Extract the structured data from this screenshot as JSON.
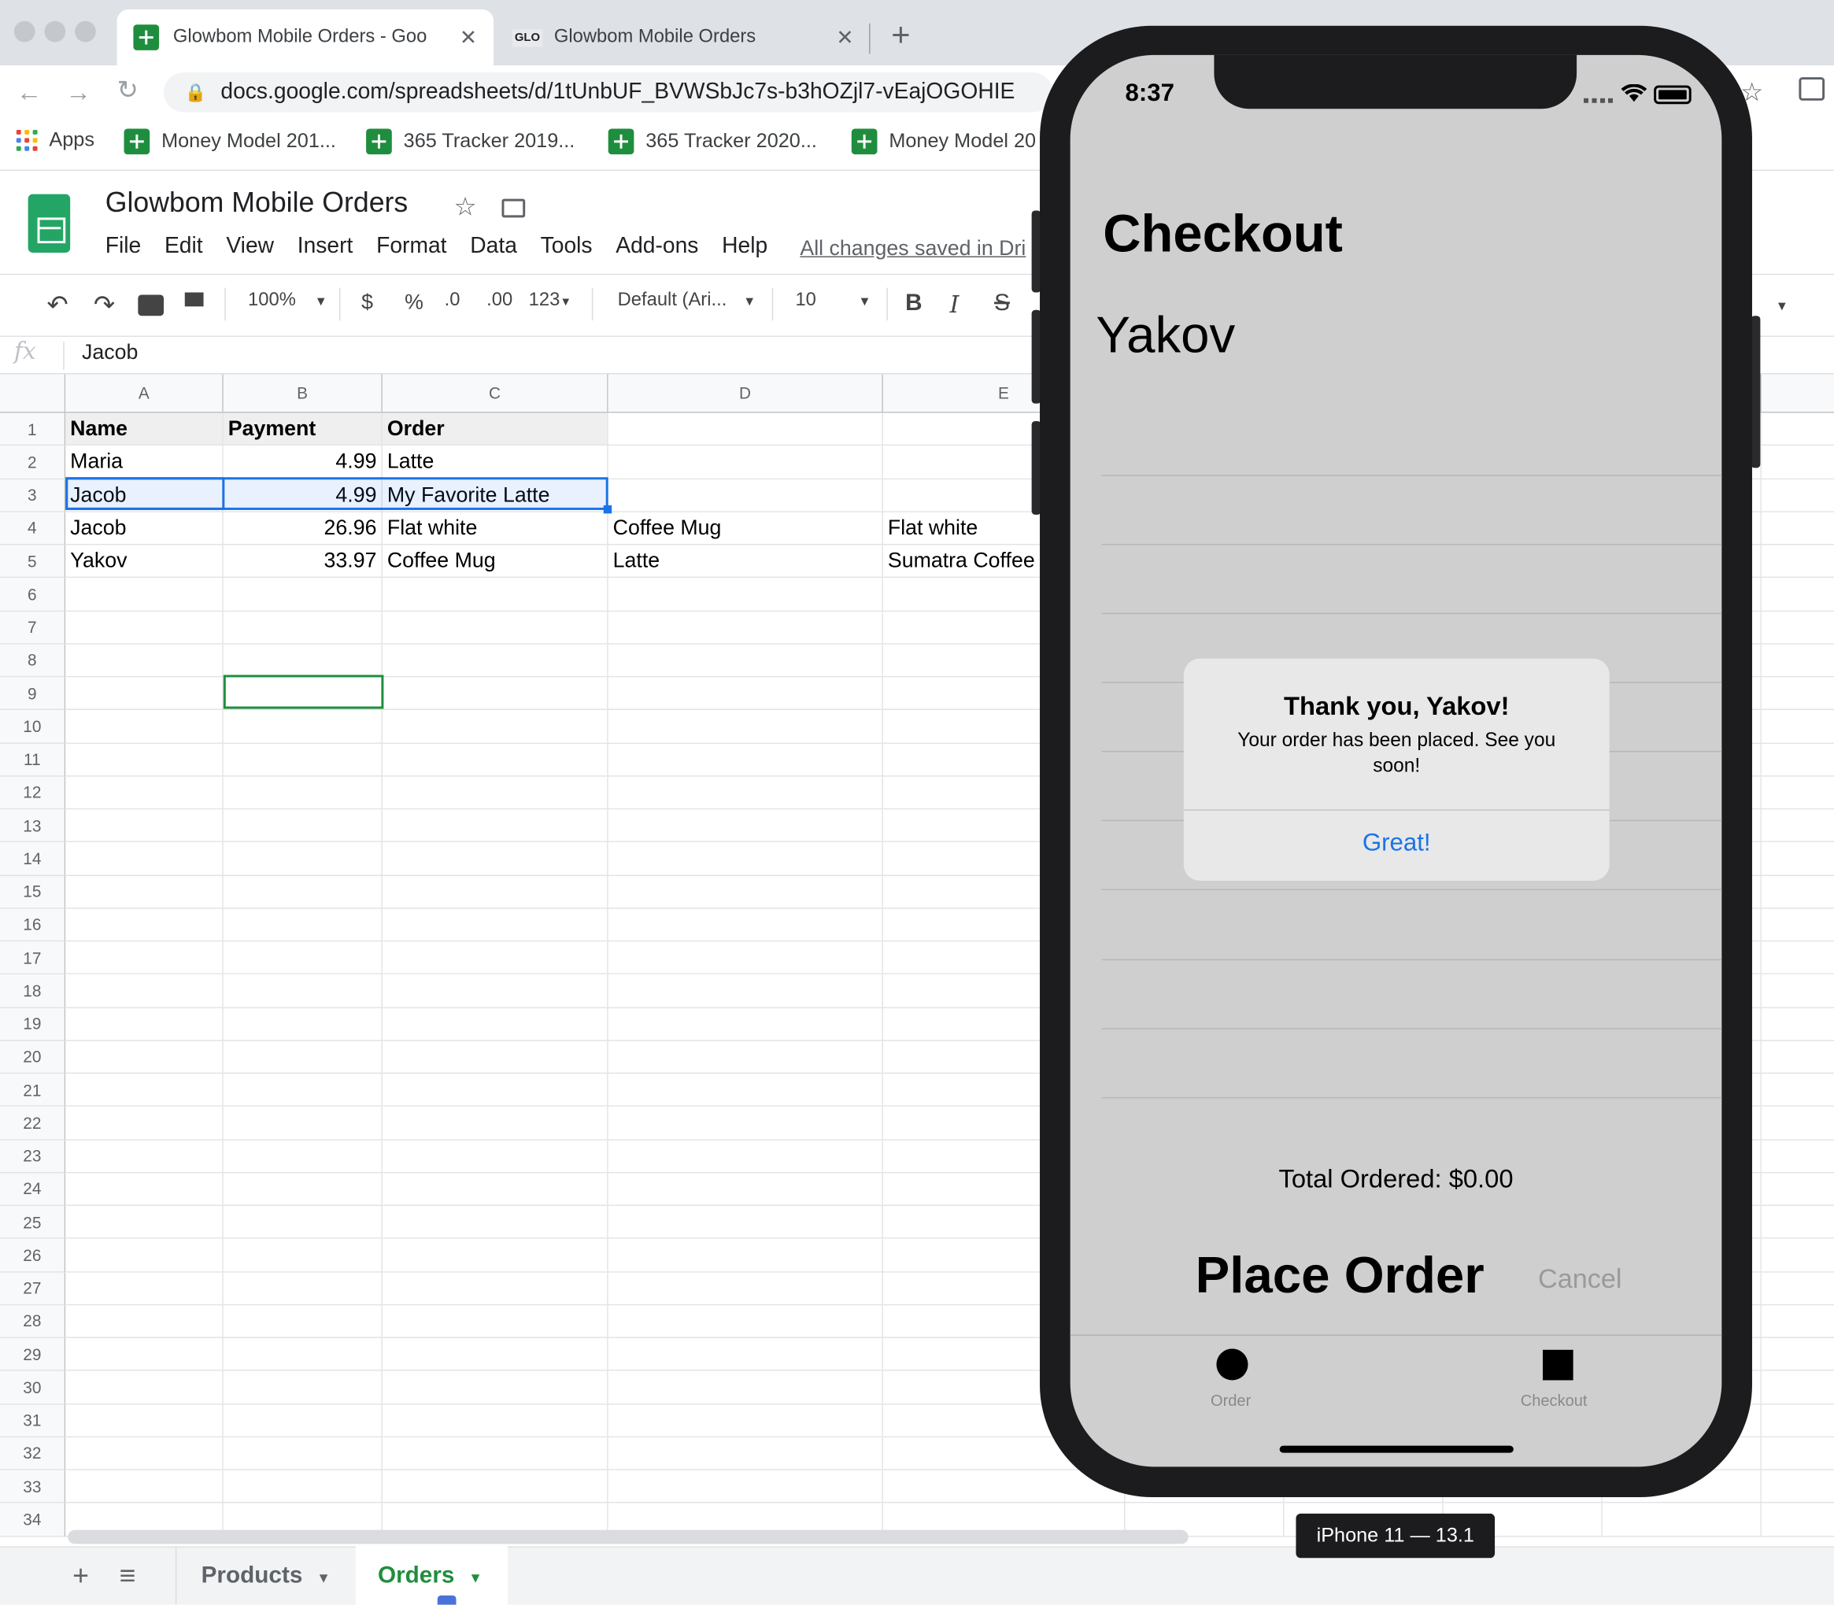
{
  "browser": {
    "tabs": [
      {
        "title": "Glowbom Mobile Orders - Goo",
        "close": "✕"
      },
      {
        "favicon": "GLO",
        "title": "Glowbom Mobile Orders",
        "close": "✕"
      }
    ],
    "new_tab": "+",
    "url": "docs.google.com/spreadsheets/d/1tUnbUF_BVWSbJc7s-b3hOZjl7-vEajOGOHIE",
    "bookmarks": [
      "Apps",
      "Money Model 201...",
      "365 Tracker 2019...",
      "365 Tracker 2020...",
      "Money Model 20"
    ]
  },
  "sheets": {
    "doc_title": "Glowbom Mobile Orders",
    "menu": [
      "File",
      "Edit",
      "View",
      "Insert",
      "Format",
      "Data",
      "Tools",
      "Add-ons",
      "Help"
    ],
    "saved_status": "All changes saved in Dri",
    "toolbar": {
      "zoom": "100%",
      "currency": "$",
      "percent": "%",
      "dec_decrease": ".0",
      "dec_increase": ".00",
      "number_format": "123",
      "font": "Default (Ari...",
      "font_size": "10",
      "bold": "B",
      "italic": "I",
      "strike": "S"
    },
    "fx_label": "fx",
    "formula_value": "Jacob",
    "columns": [
      "A",
      "B",
      "C",
      "D",
      "E"
    ],
    "rows": [
      "1",
      "2",
      "3",
      "4",
      "5",
      "6",
      "7",
      "8",
      "9",
      "10",
      "11",
      "12",
      "13",
      "14",
      "15",
      "16",
      "17",
      "18",
      "19",
      "20",
      "21",
      "22",
      "23",
      "24",
      "25",
      "26",
      "27",
      "28",
      "29",
      "30",
      "31",
      "32",
      "33",
      "34"
    ],
    "cells": [
      [
        "Name",
        "Payment",
        "Order",
        "",
        ""
      ],
      [
        "Maria",
        "4.99",
        "Latte",
        "",
        ""
      ],
      [
        "Jacob",
        "4.99",
        "My Favorite Latte",
        "",
        ""
      ],
      [
        "Jacob",
        "26.96",
        "Flat white",
        "Coffee Mug",
        "Flat white"
      ],
      [
        "Yakov",
        "33.97",
        "Coffee Mug",
        "Latte",
        "Sumatra Coffee I"
      ]
    ],
    "sheet_tabs": {
      "add": "+",
      "list": "≡",
      "products": "Products",
      "orders": "Orders"
    }
  },
  "simulator": {
    "status_time": "8:37",
    "screen_title": "Checkout",
    "customer_name": "Yakov",
    "total": "Total Ordered: $0.00",
    "place_order": "Place Order",
    "cancel": "Cancel",
    "tabs": [
      "Order",
      "Checkout"
    ],
    "alert": {
      "title": "Thank you, Yakov!",
      "message": "Your order has been placed. See you soon!",
      "button": "Great!"
    },
    "device_label": "iPhone 11 — 13.1"
  },
  "colors": {
    "sheets_green": "#1e8e3e",
    "selection_blue": "#1a73e8",
    "alert_button": "#1a73e8"
  }
}
